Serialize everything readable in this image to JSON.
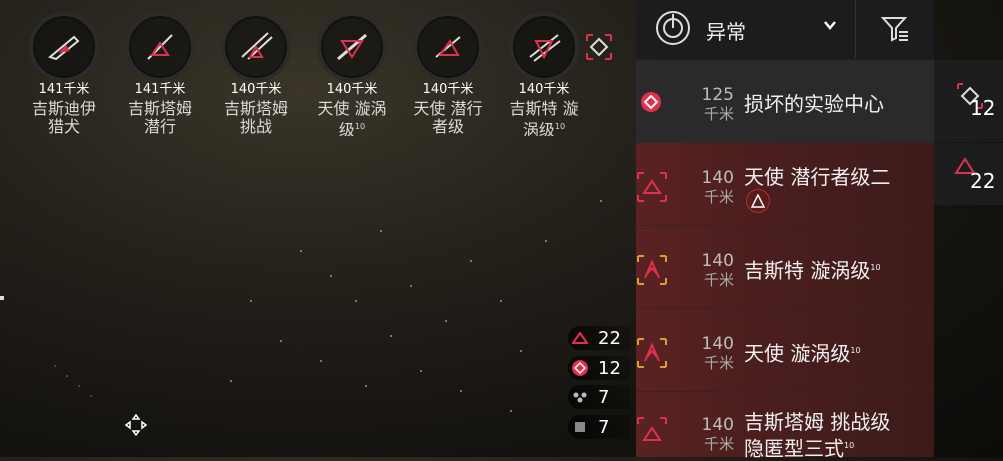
{
  "targets": [
    {
      "distance": "141千米",
      "name": "吉斯迪伊 猎犬"
    },
    {
      "distance": "141千米",
      "name": "吉斯塔姆 潜行"
    },
    {
      "distance": "140千米",
      "name": "吉斯塔姆 挑战"
    },
    {
      "distance": "140千米",
      "name": "天使 漩涡级",
      "sup": "10"
    },
    {
      "distance": "140千米",
      "name": "天使 潜行者级"
    },
    {
      "distance": "140千米",
      "name": "吉斯特 漩涡级",
      "sup": "10"
    }
  ],
  "counters": [
    {
      "icon": "hostile-triangle-icon",
      "value": "22",
      "color": "#e0314a"
    },
    {
      "icon": "diamond-icon",
      "value": "12",
      "color": "#e0314a"
    },
    {
      "icon": "drone-icon",
      "value": "7",
      "color": "#bbbbbb"
    },
    {
      "icon": "square-icon",
      "value": "7",
      "color": "#888888"
    }
  ],
  "overview": {
    "filter": "异常",
    "rows": [
      {
        "distance": "125",
        "unit": "千米",
        "name": "损坏的实验中心",
        "type": "neutral"
      },
      {
        "distance": "140",
        "unit": "千米",
        "name": "天使 潜行者级二",
        "type": "hostile",
        "badge": true
      },
      {
        "distance": "140",
        "unit": "千米",
        "name": "吉斯特 漩涡级",
        "sup": "10",
        "type": "hostile"
      },
      {
        "distance": "140",
        "unit": "千米",
        "name": "天使 漩涡级",
        "sup": "10",
        "type": "hostile"
      },
      {
        "distance": "140",
        "unit": "千米",
        "name": "吉斯塔姆 挑战级",
        "name2": "隐匿型三式",
        "sup": "10",
        "type": "hostile"
      }
    ]
  },
  "side": [
    {
      "icon": "diamond-icon",
      "value": "12"
    },
    {
      "icon": "hostile-triangle-icon",
      "value": "22"
    }
  ],
  "colors": {
    "hostile": "#e0314a",
    "panel": "#1c1c1e"
  }
}
